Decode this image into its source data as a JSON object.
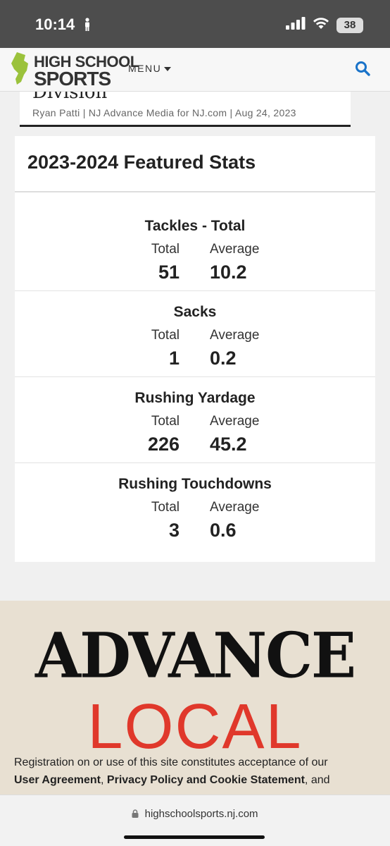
{
  "status_bar": {
    "time": "10:14",
    "battery": "38"
  },
  "header": {
    "logo_line1": "HIGH SCHOOL",
    "logo_line2": "SPORTS",
    "menu_label": "MENU"
  },
  "article": {
    "title": "Division",
    "byline": "Ryan Patti | NJ Advance Media for NJ.com | Aug 24, 2023"
  },
  "stats": {
    "title": "2023-2024 Featured Stats",
    "total_label": "Total",
    "average_label": "Average",
    "items": [
      {
        "name": "Tackles - Total",
        "total": "51",
        "average": "10.2"
      },
      {
        "name": "Sacks",
        "total": "1",
        "average": "0.2"
      },
      {
        "name": "Rushing Yardage",
        "total": "226",
        "average": "45.2"
      },
      {
        "name": "Rushing Touchdowns",
        "total": "3",
        "average": "0.6"
      }
    ]
  },
  "footer": {
    "advance": "ADVANCE",
    "local": "LOCAL",
    "legal_prefix": "Registration on or use of this site constitutes acceptance of our",
    "user_agreement": "User Agreement",
    "comma": ",",
    "privacy": "Privacy Policy and Cookie Statement",
    "and": ", and"
  },
  "url_bar": {
    "url": "highschoolsports.nj.com"
  },
  "colors": {
    "status_bar": "#4d4d4d",
    "logo_green": "#9bc23c",
    "search_blue": "#1a73c9",
    "local_red": "#e0382b",
    "footer_bg": "#e8e0d2"
  }
}
